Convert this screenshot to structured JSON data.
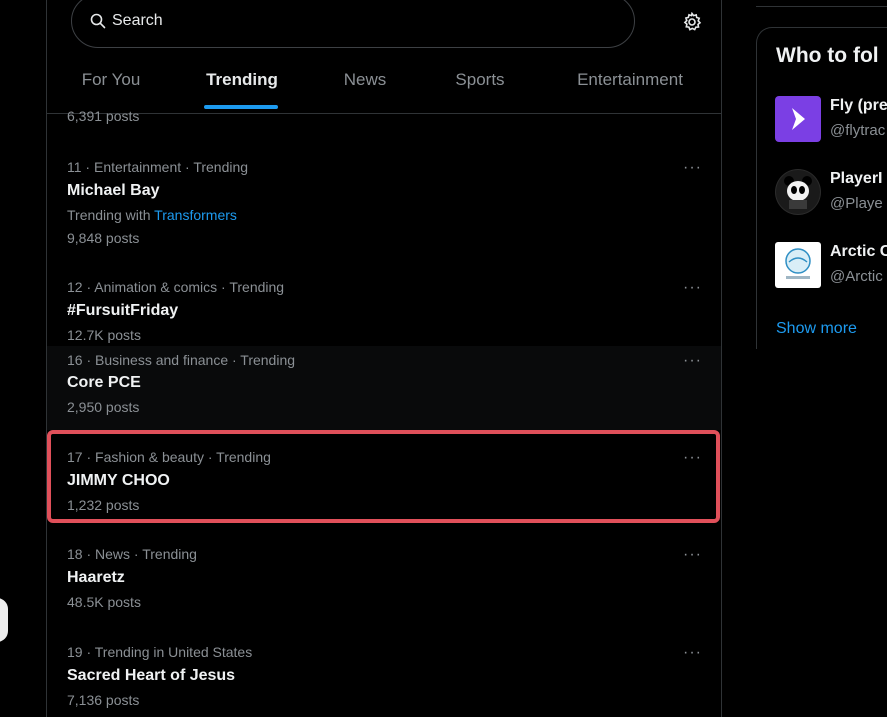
{
  "search": {
    "placeholder": "Search",
    "icon": "search-icon"
  },
  "settings_icon": "gear-icon",
  "tabs": [
    {
      "label": "For You",
      "active": false
    },
    {
      "label": "Trending",
      "active": true
    },
    {
      "label": "News",
      "active": false
    },
    {
      "label": "Sports",
      "active": false
    },
    {
      "label": "Entertainment",
      "active": false
    }
  ],
  "top_partial_count": "6,391 posts",
  "trends": [
    {
      "meta": "11 · Entertainment · Trending",
      "name": "Michael Bay",
      "trending_with_label": "Trending with",
      "trending_with_link": "Transformers",
      "count": "9,848 posts"
    },
    {
      "meta": "12 · Animation & comics · Trending",
      "name": "#FursuitFriday",
      "count": "12.7K posts"
    },
    {
      "meta": "16 · Business and finance · Trending",
      "name": "Core PCE",
      "count": "2,950 posts"
    },
    {
      "meta": "17 · Fashion & beauty · Trending",
      "name": "JIMMY CHOO",
      "count": "1,232 posts",
      "highlighted": true
    },
    {
      "meta": "18 · News · Trending",
      "name": "Haaretz",
      "count": "48.5K posts"
    },
    {
      "meta": "19 · Trending in United States",
      "name": "Sacred Heart of Jesus",
      "count": "7,136 posts"
    }
  ],
  "more_label": "···",
  "who_to_follow": {
    "title": "Who to fol",
    "accounts": [
      {
        "name": "Fly (pre",
        "handle": "@flytrac",
        "avatar_color": "#7b3fe4"
      },
      {
        "name": "PlayerI",
        "handle": "@Playe",
        "avatar_color": "#333333"
      },
      {
        "name": "Arctic C",
        "handle": "@Arctic",
        "avatar_color": "#ffffff"
      }
    ],
    "show_more": "Show more"
  },
  "colors": {
    "accent": "#1d9bf0",
    "highlight": "#e0505a",
    "muted": "#8b9095"
  }
}
